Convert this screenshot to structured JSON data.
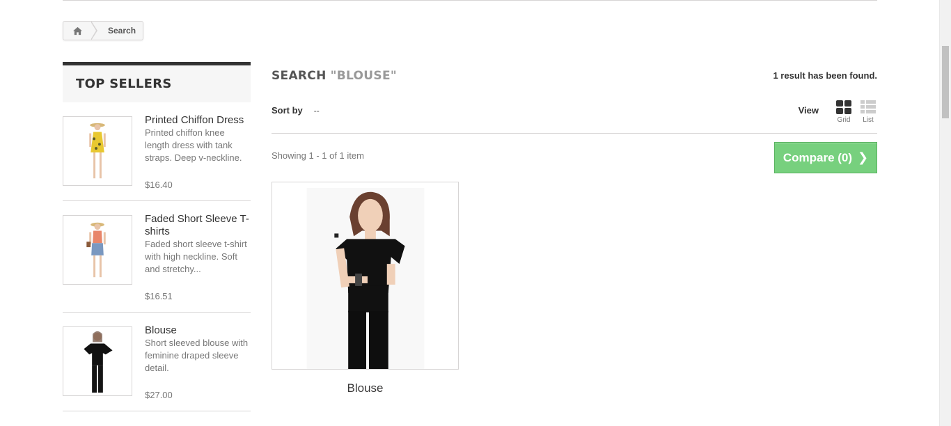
{
  "breadcrumb": {
    "home_icon": "home-icon",
    "current": "Search"
  },
  "sidebar": {
    "title": "TOP SELLERS",
    "items": [
      {
        "name": "Printed Chiffon Dress",
        "description": "Printed chiffon knee length dress with tank straps. Deep v-neckline.",
        "price": "$16.40"
      },
      {
        "name": "Faded Short Sleeve T-shirts",
        "description": "Faded short sleeve t-shirt with high neckline. Soft and stretchy...",
        "price": "$16.51"
      },
      {
        "name": "Blouse",
        "description": "Short sleeved blouse with feminine draped sleeve detail.",
        "price": "$27.00"
      }
    ]
  },
  "main": {
    "heading": "SEARCH",
    "query": "\"BLOUSE\"",
    "result_count": "1 result has been found.",
    "sort_label": "Sort by",
    "sort_value": "--",
    "view_label": "View",
    "view_grid": "Grid",
    "view_list": "List",
    "showing": "Showing 1 - 1 of 1 item",
    "compare_label": "Compare (0)",
    "compare_icon": "chevron-right-icon",
    "product": {
      "name": "Blouse"
    }
  },
  "colors": {
    "compare_bg": "#77d07e",
    "dark": "#333333",
    "muted": "#777777"
  }
}
